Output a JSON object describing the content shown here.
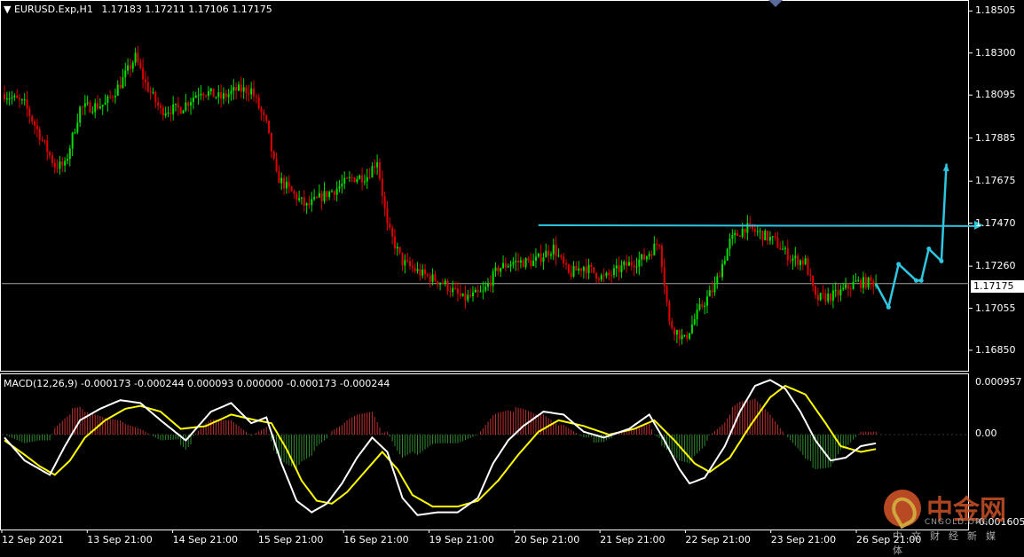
{
  "header": {
    "symbol": "EURUSD.Exp,H1",
    "ohlc": "1.17183 1.17211 1.17106 1.17175",
    "macd_label": "MACD(12,26,9) -0.000173 -0.000244 0.000093 0.000000 -0.000173 -0.000244"
  },
  "current_price": "1.17175",
  "colors": {
    "background": "#000000",
    "bull_candle": "#00e000",
    "bear_candle": "#e00000",
    "annotation": "#2ec6e0",
    "macd_line": "#ffffff",
    "signal_line": "#ffff00",
    "hist_pos": "#c03030",
    "hist_neg": "#2f8a2f",
    "price_line": "#a0a0a0"
  },
  "chart_data": {
    "type": "line",
    "price_axis": {
      "ticks": [
        "1.18505",
        "1.18300",
        "1.18095",
        "1.17885",
        "1.17675",
        "1.17470",
        "1.17260",
        "1.17175",
        "1.17055",
        "1.16850"
      ],
      "range": [
        1.1675,
        1.1855
      ]
    },
    "macd_axis": {
      "ticks": [
        "0.000957",
        "0.00",
        "-0.001605"
      ],
      "range": [
        -0.00165,
        0.00105
      ]
    },
    "x_ticks": [
      "12 Sep 2021",
      "13 Sep 21:00",
      "14 Sep 21:00",
      "15 Sep 21:00",
      "16 Sep 21:00",
      "19 Sep 21:00",
      "20 Sep 21:00",
      "21 Sep 21:00",
      "22 Sep 21:00",
      "23 Sep 21:00",
      "26 Sep 21:00"
    ],
    "price_keypoints": [
      [
        0,
        1.181
      ],
      [
        8,
        1.1805
      ],
      [
        14,
        1.179
      ],
      [
        20,
        1.1775
      ],
      [
        24,
        1.1775
      ],
      [
        30,
        1.1803
      ],
      [
        40,
        1.1805
      ],
      [
        46,
        1.1815
      ],
      [
        52,
        1.1828
      ],
      [
        56,
        1.1815
      ],
      [
        62,
        1.1802
      ],
      [
        70,
        1.1803
      ],
      [
        78,
        1.1812
      ],
      [
        86,
        1.1808
      ],
      [
        92,
        1.1812
      ],
      [
        98,
        1.1812
      ],
      [
        104,
        1.1795
      ],
      [
        108,
        1.177
      ],
      [
        114,
        1.1762
      ],
      [
        120,
        1.1755
      ],
      [
        126,
        1.176
      ],
      [
        132,
        1.1764
      ],
      [
        138,
        1.1769
      ],
      [
        144,
        1.177
      ],
      [
        148,
        1.1778
      ],
      [
        152,
        1.1745
      ],
      [
        158,
        1.1728
      ],
      [
        166,
        1.1722
      ],
      [
        174,
        1.1718
      ],
      [
        182,
        1.171
      ],
      [
        190,
        1.1713
      ],
      [
        196,
        1.1725
      ],
      [
        202,
        1.1728
      ],
      [
        210,
        1.1728
      ],
      [
        218,
        1.1735
      ],
      [
        224,
        1.1722
      ],
      [
        230,
        1.1726
      ],
      [
        238,
        1.172
      ],
      [
        246,
        1.1726
      ],
      [
        254,
        1.173
      ],
      [
        260,
        1.1738
      ],
      [
        264,
        1.1698
      ],
      [
        270,
        1.169
      ],
      [
        276,
        1.1705
      ],
      [
        282,
        1.1716
      ],
      [
        288,
        1.1738
      ],
      [
        294,
        1.1745
      ],
      [
        300,
        1.1742
      ],
      [
        306,
        1.1738
      ],
      [
        312,
        1.173
      ],
      [
        318,
        1.1728
      ],
      [
        322,
        1.171
      ],
      [
        330,
        1.1712
      ],
      [
        338,
        1.1718
      ],
      [
        346,
        1.1718
      ]
    ],
    "macd_keypoints": [
      [
        0,
        -5e-05
      ],
      [
        8,
        -0.00045
      ],
      [
        14,
        -0.0006
      ],
      [
        18,
        -0.0007
      ],
      [
        24,
        -0.0002
      ],
      [
        30,
        0.00025
      ],
      [
        38,
        0.00045
      ],
      [
        46,
        0.0006
      ],
      [
        54,
        0.00055
      ],
      [
        62,
        0.00025
      ],
      [
        72,
        -0.0001
      ],
      [
        82,
        0.0004
      ],
      [
        90,
        0.00055
      ],
      [
        98,
        0.0002
      ],
      [
        104,
        0.0003
      ],
      [
        110,
        -0.0005
      ],
      [
        116,
        -0.00115
      ],
      [
        122,
        -0.00135
      ],
      [
        128,
        -0.0012
      ],
      [
        134,
        -0.00085
      ],
      [
        140,
        -0.0004
      ],
      [
        146,
        -5e-05
      ],
      [
        152,
        -0.0003
      ],
      [
        158,
        -0.0011
      ],
      [
        164,
        -0.0014
      ],
      [
        172,
        -0.00135
      ],
      [
        180,
        -0.00135
      ],
      [
        188,
        -0.0011
      ],
      [
        194,
        -0.0005
      ],
      [
        200,
        -0.0001
      ],
      [
        206,
        0.00015
      ],
      [
        214,
        0.0004
      ],
      [
        222,
        0.00035
      ],
      [
        230,
        5e-05
      ],
      [
        238,
        -5e-05
      ],
      [
        248,
        0.0001
      ],
      [
        256,
        0.00035
      ],
      [
        262,
        -0.0001
      ],
      [
        268,
        -0.0006
      ],
      [
        272,
        -0.00085
      ],
      [
        278,
        -0.00075
      ],
      [
        286,
        -0.0002
      ],
      [
        292,
        0.0004
      ],
      [
        298,
        0.00085
      ],
      [
        304,
        0.00095
      ],
      [
        310,
        0.0008
      ],
      [
        316,
        0.0004
      ],
      [
        322,
        -0.0001
      ],
      [
        328,
        -0.00045
      ],
      [
        334,
        -0.0004
      ],
      [
        340,
        -0.0002
      ],
      [
        346,
        -0.00015
      ]
    ],
    "signal_keypoints": [
      [
        0,
        -0.0001
      ],
      [
        8,
        -0.00035
      ],
      [
        14,
        -0.00055
      ],
      [
        20,
        -0.0007
      ],
      [
        26,
        -0.00045
      ],
      [
        32,
        -5e-05
      ],
      [
        40,
        0.00025
      ],
      [
        48,
        0.00045
      ],
      [
        54,
        0.0005
      ],
      [
        62,
        0.0004
      ],
      [
        70,
        0.0001
      ],
      [
        80,
        0.00015
      ],
      [
        90,
        0.00035
      ],
      [
        100,
        0.00025
      ],
      [
        106,
        0.0002
      ],
      [
        112,
        -0.00025
      ],
      [
        118,
        -0.0008
      ],
      [
        124,
        -0.00115
      ],
      [
        130,
        -0.0012
      ],
      [
        136,
        -0.001
      ],
      [
        142,
        -0.0007
      ],
      [
        150,
        -0.0003
      ],
      [
        156,
        -0.0006
      ],
      [
        162,
        -0.00105
      ],
      [
        170,
        -0.00125
      ],
      [
        180,
        -0.00125
      ],
      [
        188,
        -0.00115
      ],
      [
        196,
        -0.0008
      ],
      [
        204,
        -0.00035
      ],
      [
        212,
        5e-05
      ],
      [
        220,
        0.00025
      ],
      [
        230,
        0.00015
      ],
      [
        240,
        0.0
      ],
      [
        250,
        0.0001
      ],
      [
        258,
        0.00025
      ],
      [
        266,
        -0.0001
      ],
      [
        274,
        -0.0005
      ],
      [
        280,
        -0.00065
      ],
      [
        288,
        -0.0004
      ],
      [
        296,
        0.00015
      ],
      [
        304,
        0.00065
      ],
      [
        310,
        0.00085
      ],
      [
        318,
        0.0007
      ],
      [
        326,
        0.0002
      ],
      [
        332,
        -0.0002
      ],
      [
        340,
        -0.0003
      ],
      [
        346,
        -0.00025
      ]
    ],
    "resistance_level": 1.1746,
    "forecast_path": [
      [
        346,
        1.17175
      ],
      [
        351,
        1.1706
      ],
      [
        355,
        1.1727
      ],
      [
        362,
        1.1719
      ],
      [
        364,
        1.1719
      ],
      [
        367,
        1.17345
      ],
      [
        372,
        1.17285
      ],
      [
        374,
        1.1776
      ]
    ]
  }
}
